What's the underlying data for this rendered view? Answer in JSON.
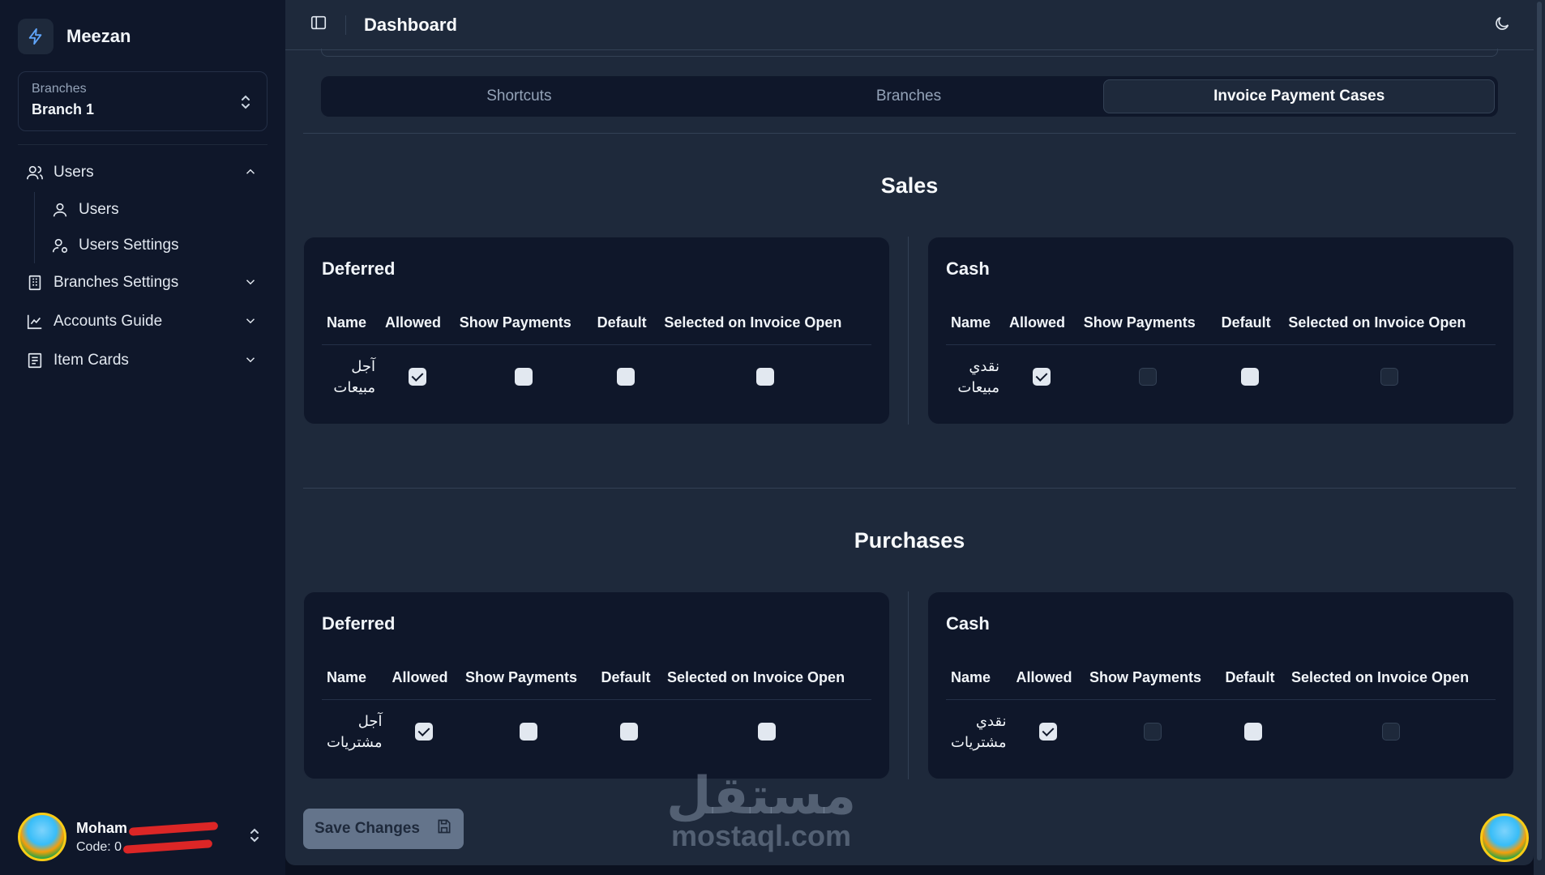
{
  "app": {
    "name": "Meezan"
  },
  "branch_select": {
    "caption": "Branches",
    "value": "Branch 1"
  },
  "nav": {
    "users": {
      "label": "Users",
      "sub": [
        {
          "label": "Users"
        },
        {
          "label": "Users Settings"
        }
      ]
    },
    "branches_settings": {
      "label": "Branches Settings"
    },
    "accounts_guide": {
      "label": "Accounts Guide"
    },
    "item_cards": {
      "label": "Item Cards"
    }
  },
  "user": {
    "name": "Moham",
    "code": "Code: 0"
  },
  "topbar": {
    "title": "Dashboard"
  },
  "tabs": [
    {
      "label": "Shortcuts",
      "active": false
    },
    {
      "label": "Branches",
      "active": false
    },
    {
      "label": "Invoice Payment Cases",
      "active": true
    }
  ],
  "columns": [
    "Name",
    "Allowed",
    "Show Payments",
    "Default",
    "Selected on Invoice Open"
  ],
  "sections": [
    {
      "title": "Sales",
      "cards": [
        {
          "title": "Deferred",
          "row": {
            "name_line1": "آجل",
            "name_line2": "مبيعات",
            "allowed": true,
            "show_payments": false,
            "default": false,
            "selected_on_open": false,
            "disabled": []
          }
        },
        {
          "title": "Cash",
          "row": {
            "name_line1": "نقدي",
            "name_line2": "مبيعات",
            "allowed": true,
            "show_payments": false,
            "default": false,
            "selected_on_open": false,
            "disabled": [
              "show_payments",
              "selected_on_open"
            ]
          }
        }
      ]
    },
    {
      "title": "Purchases",
      "cards": [
        {
          "title": "Deferred",
          "row": {
            "name_line1": "آجل",
            "name_line2": "مشتريات",
            "allowed": true,
            "show_payments": false,
            "default": false,
            "selected_on_open": false,
            "disabled": []
          }
        },
        {
          "title": "Cash",
          "row": {
            "name_line1": "نقدي",
            "name_line2": "مشتريات",
            "allowed": true,
            "show_payments": false,
            "default": false,
            "selected_on_open": false,
            "disabled": [
              "show_payments",
              "selected_on_open"
            ]
          }
        }
      ]
    }
  ],
  "save_button": {
    "label": "Save Changes"
  },
  "watermark": {
    "arabic": "مستقل",
    "latin": "mostaql.com"
  },
  "icons": [
    "bolt-icon",
    "chevron-updown-icon",
    "users-icon",
    "user-icon",
    "user-settings-icon",
    "building-icon",
    "chart-icon",
    "cards-icon",
    "chevron-up-icon",
    "chevron-down-icon",
    "sidebar-toggle-icon",
    "moon-icon",
    "save-icon"
  ]
}
